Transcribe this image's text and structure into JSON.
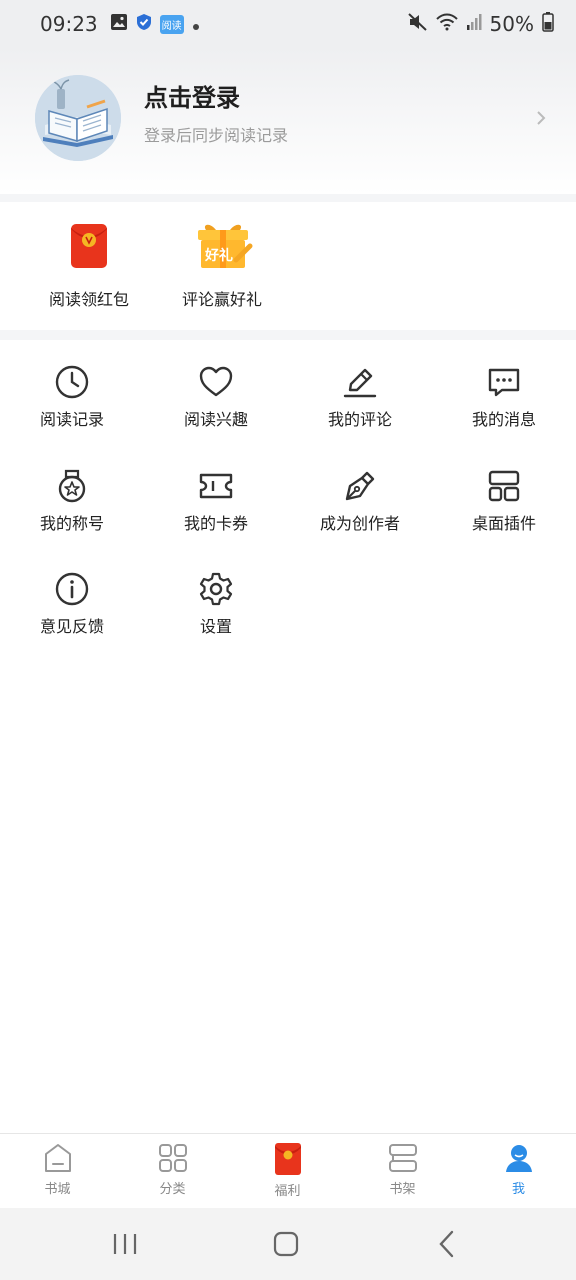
{
  "status": {
    "time": "09:23",
    "battery": "50%",
    "app_badge": "阅读"
  },
  "profile": {
    "title": "点击登录",
    "subtitle": "登录后同步阅读记录"
  },
  "promos": [
    {
      "label": "阅读领红包",
      "icon": "red-envelope-icon"
    },
    {
      "label": "评论赢好礼",
      "icon": "gift-box-icon",
      "badge": "好礼"
    }
  ],
  "menu": [
    {
      "label": "阅读记录",
      "icon": "clock-icon"
    },
    {
      "label": "阅读兴趣",
      "icon": "heart-icon"
    },
    {
      "label": "我的评论",
      "icon": "pen-edit-icon"
    },
    {
      "label": "我的消息",
      "icon": "message-icon"
    },
    {
      "label": "我的称号",
      "icon": "medal-icon"
    },
    {
      "label": "我的卡券",
      "icon": "ticket-icon"
    },
    {
      "label": "成为创作者",
      "icon": "fountain-pen-icon"
    },
    {
      "label": "桌面插件",
      "icon": "widget-icon"
    },
    {
      "label": "意见反馈",
      "icon": "info-icon"
    },
    {
      "label": "设置",
      "icon": "gear-icon"
    }
  ],
  "tabs": [
    {
      "label": "书城",
      "icon": "home-icon"
    },
    {
      "label": "分类",
      "icon": "grid-icon"
    },
    {
      "label": "福利",
      "icon": "red-envelope-icon"
    },
    {
      "label": "书架",
      "icon": "bookshelf-icon"
    },
    {
      "label": "我",
      "icon": "user-icon",
      "active": true
    }
  ],
  "colors": {
    "accent": "#2b8ce6",
    "red": "#e8341c",
    "gold": "#f5b623"
  }
}
